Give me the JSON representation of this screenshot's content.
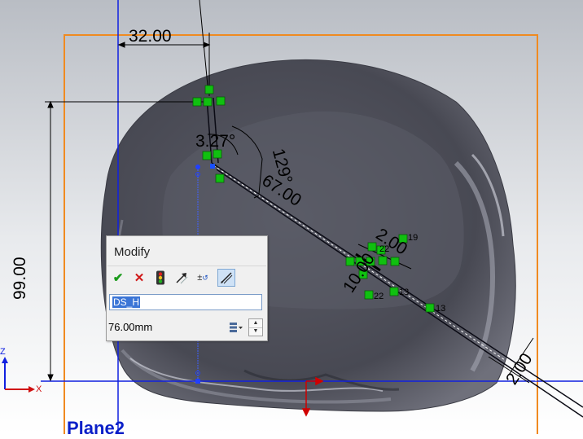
{
  "dimensions": {
    "horizontal_32": "32.00",
    "vertical_99": "99.00",
    "angle_3_27": "3.27°",
    "angle_129": "129°",
    "length_67": "67.00",
    "thickness_2_top": "2.00",
    "width_10": "10.00",
    "thickness_2_bottom": "2.00"
  },
  "plane_label": "Plane2",
  "relation_numbers": [
    "19",
    "22",
    "22",
    "13",
    "13"
  ],
  "modify_dialog": {
    "title": "Modify",
    "toolbar": [
      "ok-icon",
      "cancel-icon",
      "rebuild-icon",
      "reverse-direction-icon",
      "tolerance-icon",
      "mark-for-drawing-icon"
    ],
    "name_value": "DS_H",
    "dimension_value": "76.00mm"
  },
  "triad": {
    "z_label": "Z",
    "x_label": "X"
  },
  "colors": {
    "background_top": "#b8bcc2",
    "background_bottom": "#ffffff",
    "sketch_box": "#f08a20",
    "plane_axis": "#1020e0",
    "relation_marker": "#10c010",
    "model_body": "#4d4e58"
  }
}
